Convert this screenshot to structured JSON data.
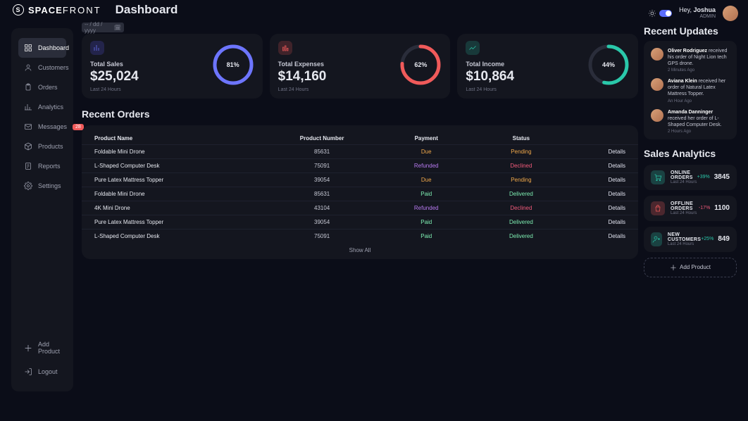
{
  "brand": {
    "mark": "S",
    "name_bold": "SPACE",
    "name_thin": "FRONT"
  },
  "page_title": "Dashboard",
  "date_input": {
    "value": "-- / dd / yyyy",
    "icon": "calendar-icon"
  },
  "user": {
    "greeting_prefix": "Hey,",
    "name": "Joshua",
    "role": "ADMIN"
  },
  "sidebar": {
    "items": [
      {
        "label": "Dashboard",
        "icon": "grid-icon",
        "active": true
      },
      {
        "label": "Customers",
        "icon": "user-icon"
      },
      {
        "label": "Orders",
        "icon": "clipboard-icon"
      },
      {
        "label": "Analytics",
        "icon": "chart-icon"
      },
      {
        "label": "Messages",
        "icon": "mail-icon",
        "badge": "28"
      },
      {
        "label": "Products",
        "icon": "box-icon"
      },
      {
        "label": "Reports",
        "icon": "report-icon"
      },
      {
        "label": "Settings",
        "icon": "gear-icon"
      }
    ],
    "add_product": "Add Product",
    "logout": "Logout"
  },
  "stats": [
    {
      "label": "Total Sales",
      "value": "$25,024",
      "sub": "Last 24 Hours",
      "pct": "81%",
      "color": "#6d75ff",
      "icon": "chart-bar-icon",
      "icon_class": "ic-purple",
      "dash": 162
    },
    {
      "label": "Total Expenses",
      "value": "$14,160",
      "sub": "Last 24 Hours",
      "pct": "62%",
      "color": "#f05a5a",
      "icon": "bars-icon",
      "icon_class": "ic-red",
      "dash": 124
    },
    {
      "label": "Total Income",
      "value": "$10,864",
      "sub": "Last 24 Hours",
      "pct": "44%",
      "color": "#2ac8aa",
      "icon": "trend-icon",
      "icon_class": "ic-teal",
      "dash": 88
    }
  ],
  "orders": {
    "title": "Recent Orders",
    "headers": [
      "Product Name",
      "Product Number",
      "Payment",
      "Status",
      ""
    ],
    "details_label": "Details",
    "show_all": "Show All",
    "rows": [
      {
        "name": "Foldable Mini Drone",
        "num": "85631",
        "pay": "Due",
        "status": "Pending"
      },
      {
        "name": "L-Shaped Computer Desk",
        "num": "75091",
        "pay": "Refunded",
        "status": "Declined"
      },
      {
        "name": "Pure Latex Mattress Topper",
        "num": "39054",
        "pay": "Due",
        "status": "Pending"
      },
      {
        "name": "Foldable Mini Drone",
        "num": "85631",
        "pay": "Paid",
        "status": "Delivered"
      },
      {
        "name": "4K Mini Drone",
        "num": "43104",
        "pay": "Refunded",
        "status": "Declined"
      },
      {
        "name": "Pure Latex Mattress Topper",
        "num": "39054",
        "pay": "Paid",
        "status": "Delivered"
      },
      {
        "name": "L-Shaped Computer Desk",
        "num": "75091",
        "pay": "Paid",
        "status": "Delivered"
      }
    ]
  },
  "updates": {
    "title": "Recent Updates",
    "items": [
      {
        "person": "Oliver Rodriguez",
        "text": "received his order of Night Lion tech GPS drone.",
        "time": "2 Minutes Ago"
      },
      {
        "person": "Aviana Klein",
        "text": "received her order of Natural Latex Mattress Topper.",
        "time": "An Hour Ago"
      },
      {
        "person": "Amanda Danninger",
        "text": "received her order of L-Shaped Computer Desk.",
        "time": "2 Hours Ago"
      }
    ]
  },
  "sales_analytics": {
    "title": "Sales Analytics",
    "cards": [
      {
        "label": "ONLINE ORDERS",
        "sub": "Last 24 Hours",
        "pct": "+39%",
        "pct_class": "pct-up",
        "value": "3845",
        "icon_class": "sa-teal",
        "icon": "cart-icon"
      },
      {
        "label": "OFFLINE ORDERS",
        "sub": "Last 24 Hours",
        "pct": "-17%",
        "pct_class": "pct-down",
        "value": "1100",
        "icon_class": "sa-red",
        "icon": "bag-icon"
      },
      {
        "label": "NEW CUSTOMERS",
        "sub": "Last 24 Hours",
        "pct": "+25%",
        "pct_class": "pct-up",
        "value": "849",
        "icon_class": "sa-teal",
        "icon": "user-plus-icon"
      }
    ],
    "add_product": "Add Product"
  },
  "colors": {
    "bg": "#0b0d18",
    "card": "#14161f",
    "accent": "#6d75ff",
    "danger": "#f05a5a",
    "success": "#2ac8aa"
  }
}
